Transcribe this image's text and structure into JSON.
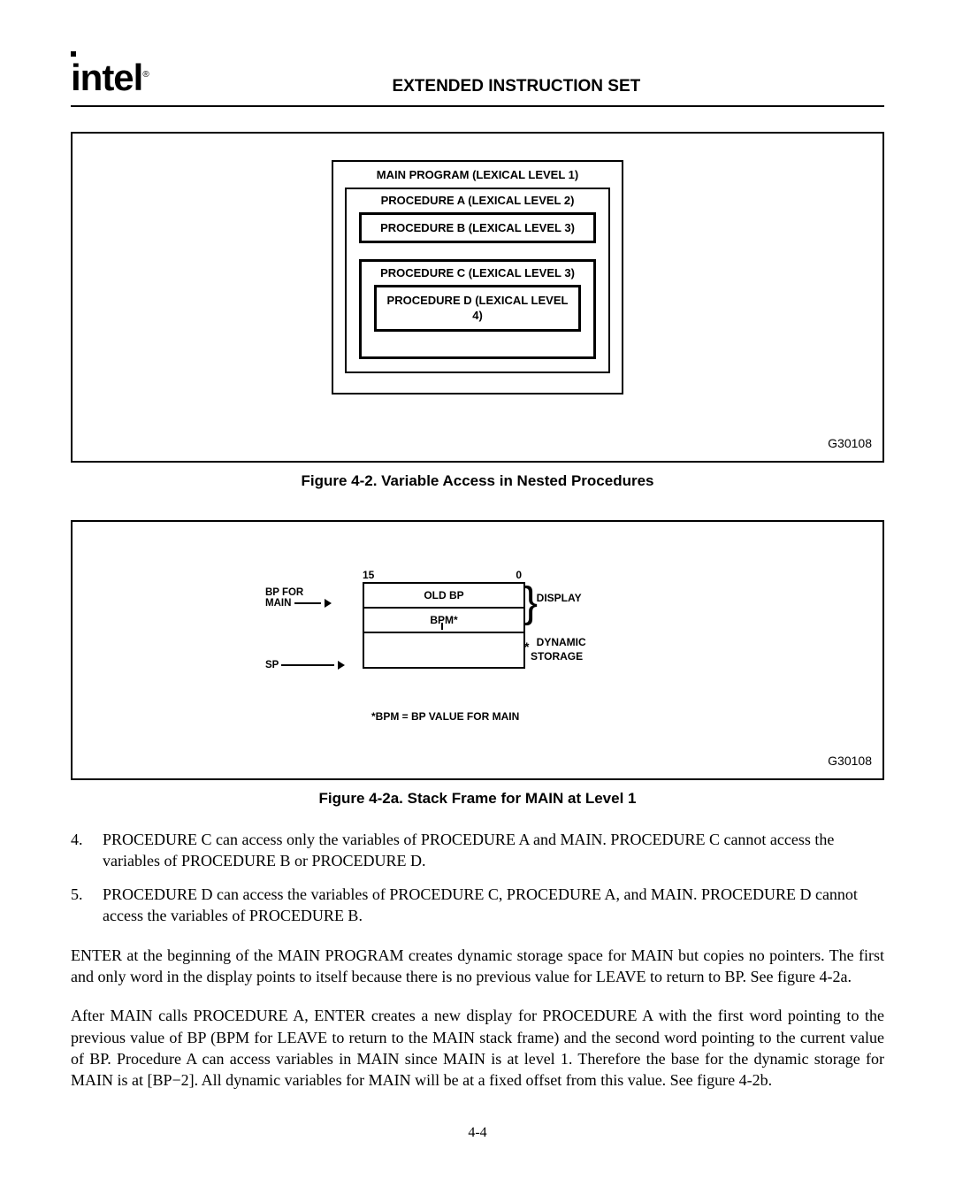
{
  "header": {
    "logo": "intel",
    "logo_reg": "®",
    "section_title": "EXTENDED INSTRUCTION SET"
  },
  "figure1": {
    "main": "MAIN PROGRAM (LEXICAL LEVEL 1)",
    "procA": "PROCEDURE A (LEXICAL LEVEL 2)",
    "procB": "PROCEDURE B (LEXICAL LEVEL 3)",
    "procC": "PROCEDURE C (LEXICAL LEVEL 3)",
    "procD": "PROCEDURE D (LEXICAL LEVEL 4)",
    "ref": "G30108",
    "caption": "Figure 4-2.  Variable Access in Nested Procedures"
  },
  "figure2": {
    "bit_hi": "15",
    "bit_lo": "0",
    "row_oldbp": "OLD BP",
    "row_bpm": "BPM*",
    "bp_label": "BP FOR\nMAIN",
    "sp_label": "SP",
    "display_label": "DISPLAY",
    "dynamic_label": "DYNAMIC\nSTORAGE",
    "footnote": "*BPM = BP VALUE FOR MAIN",
    "ref": "G30108",
    "caption": "Figure 4-2a.  Stack Frame for MAIN at Level 1"
  },
  "list": {
    "item4_num": "4.",
    "item4_text": "PROCEDURE C can access only the variables of PROCEDURE A and MAIN. PROCEDURE C cannot access the variables of PROCEDURE B or PROCEDURE D.",
    "item5_num": "5.",
    "item5_text": "PROCEDURE D can access the variables of PROCEDURE C, PROCEDURE A, and MAIN. PROCEDURE D cannot access the variables of PROCEDURE B."
  },
  "para1": "ENTER at the beginning of the MAIN PROGRAM creates dynamic storage space for MAIN but copies no pointers. The first and only word in the display points to itself because there is no previous value for LEAVE to return to BP. See figure 4-2a.",
  "para2": "After MAIN calls PROCEDURE A, ENTER creates a new display for PROCEDURE A with the first word pointing to the previous value of BP (BPM for LEAVE to return to the MAIN stack frame) and the second word pointing to the current value of BP. Procedure A can access variables in MAIN since MAIN is at level 1. Therefore the base for the dynamic storage for MAIN is at [BP−2]. All dynamic variables for MAIN will be at a fixed offset from this value. See figure 4-2b.",
  "page_number": "4-4"
}
